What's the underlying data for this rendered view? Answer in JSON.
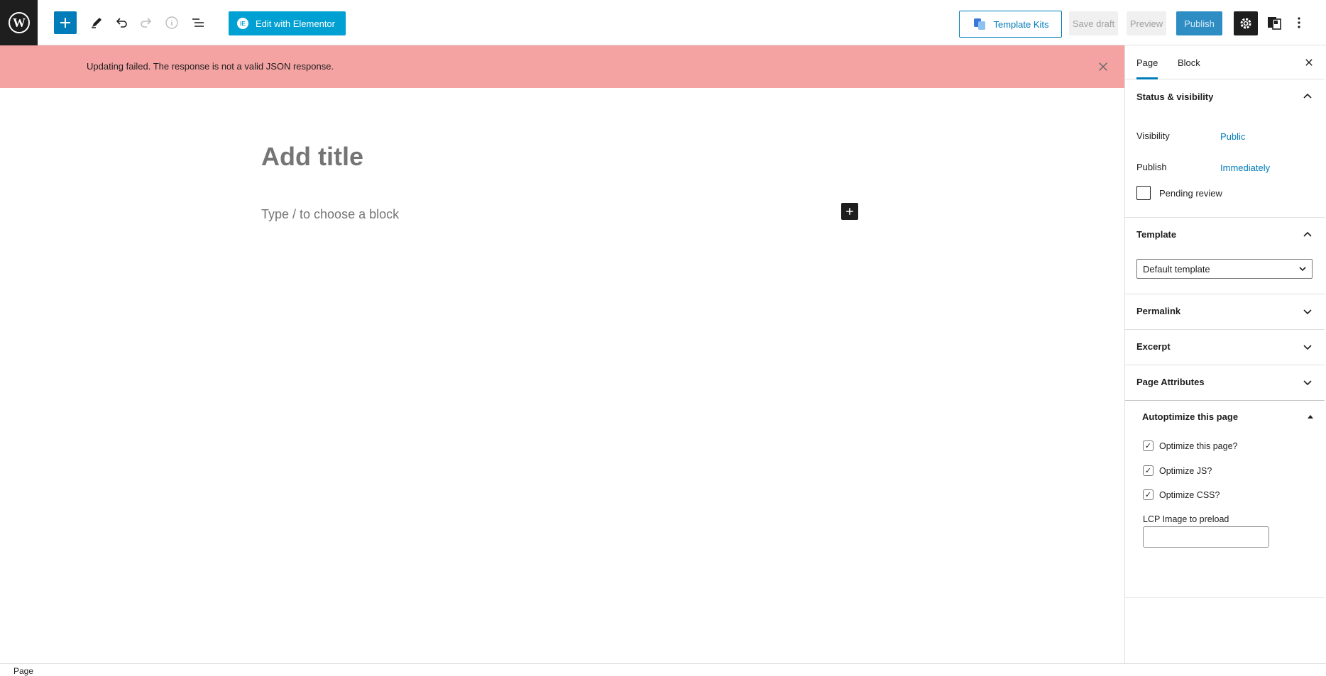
{
  "toolbar": {
    "elementor_label": "Edit with Elementor",
    "elementor_logo_text": "IE",
    "template_kits_label": "Template Kits",
    "save_draft_label": "Save draft",
    "preview_label": "Preview",
    "publish_label": "Publish"
  },
  "notice": {
    "message": "Updating failed. The response is not a valid JSON response."
  },
  "editor": {
    "title_placeholder": "Add title",
    "block_placeholder": "Type / to choose a block"
  },
  "sidebar": {
    "tabs": [
      {
        "label": "Page",
        "active": true
      },
      {
        "label": "Block",
        "active": false
      }
    ],
    "status_visibility": {
      "heading": "Status & visibility",
      "visibility_label": "Visibility",
      "visibility_value": "Public",
      "publish_label": "Publish",
      "publish_value": "Immediately",
      "pending_review_label": "Pending review"
    },
    "template": {
      "heading": "Template",
      "selected": "Default template"
    },
    "permalink": {
      "heading": "Permalink"
    },
    "excerpt": {
      "heading": "Excerpt"
    },
    "page_attributes": {
      "heading": "Page Attributes"
    },
    "autoptimize": {
      "heading": "Autoptimize this page",
      "options": [
        {
          "label": "Optimize this page?",
          "checked": true
        },
        {
          "label": "Optimize JS?",
          "checked": true
        },
        {
          "label": "Optimize CSS?",
          "checked": true
        }
      ],
      "lcp_label": "LCP Image to preload",
      "lcp_value": ""
    }
  },
  "footer": {
    "breadcrumb": "Page"
  },
  "colors": {
    "accent": "#007cba",
    "notice_bg": "#f4a2a2",
    "elementor": "#00a0d2"
  }
}
